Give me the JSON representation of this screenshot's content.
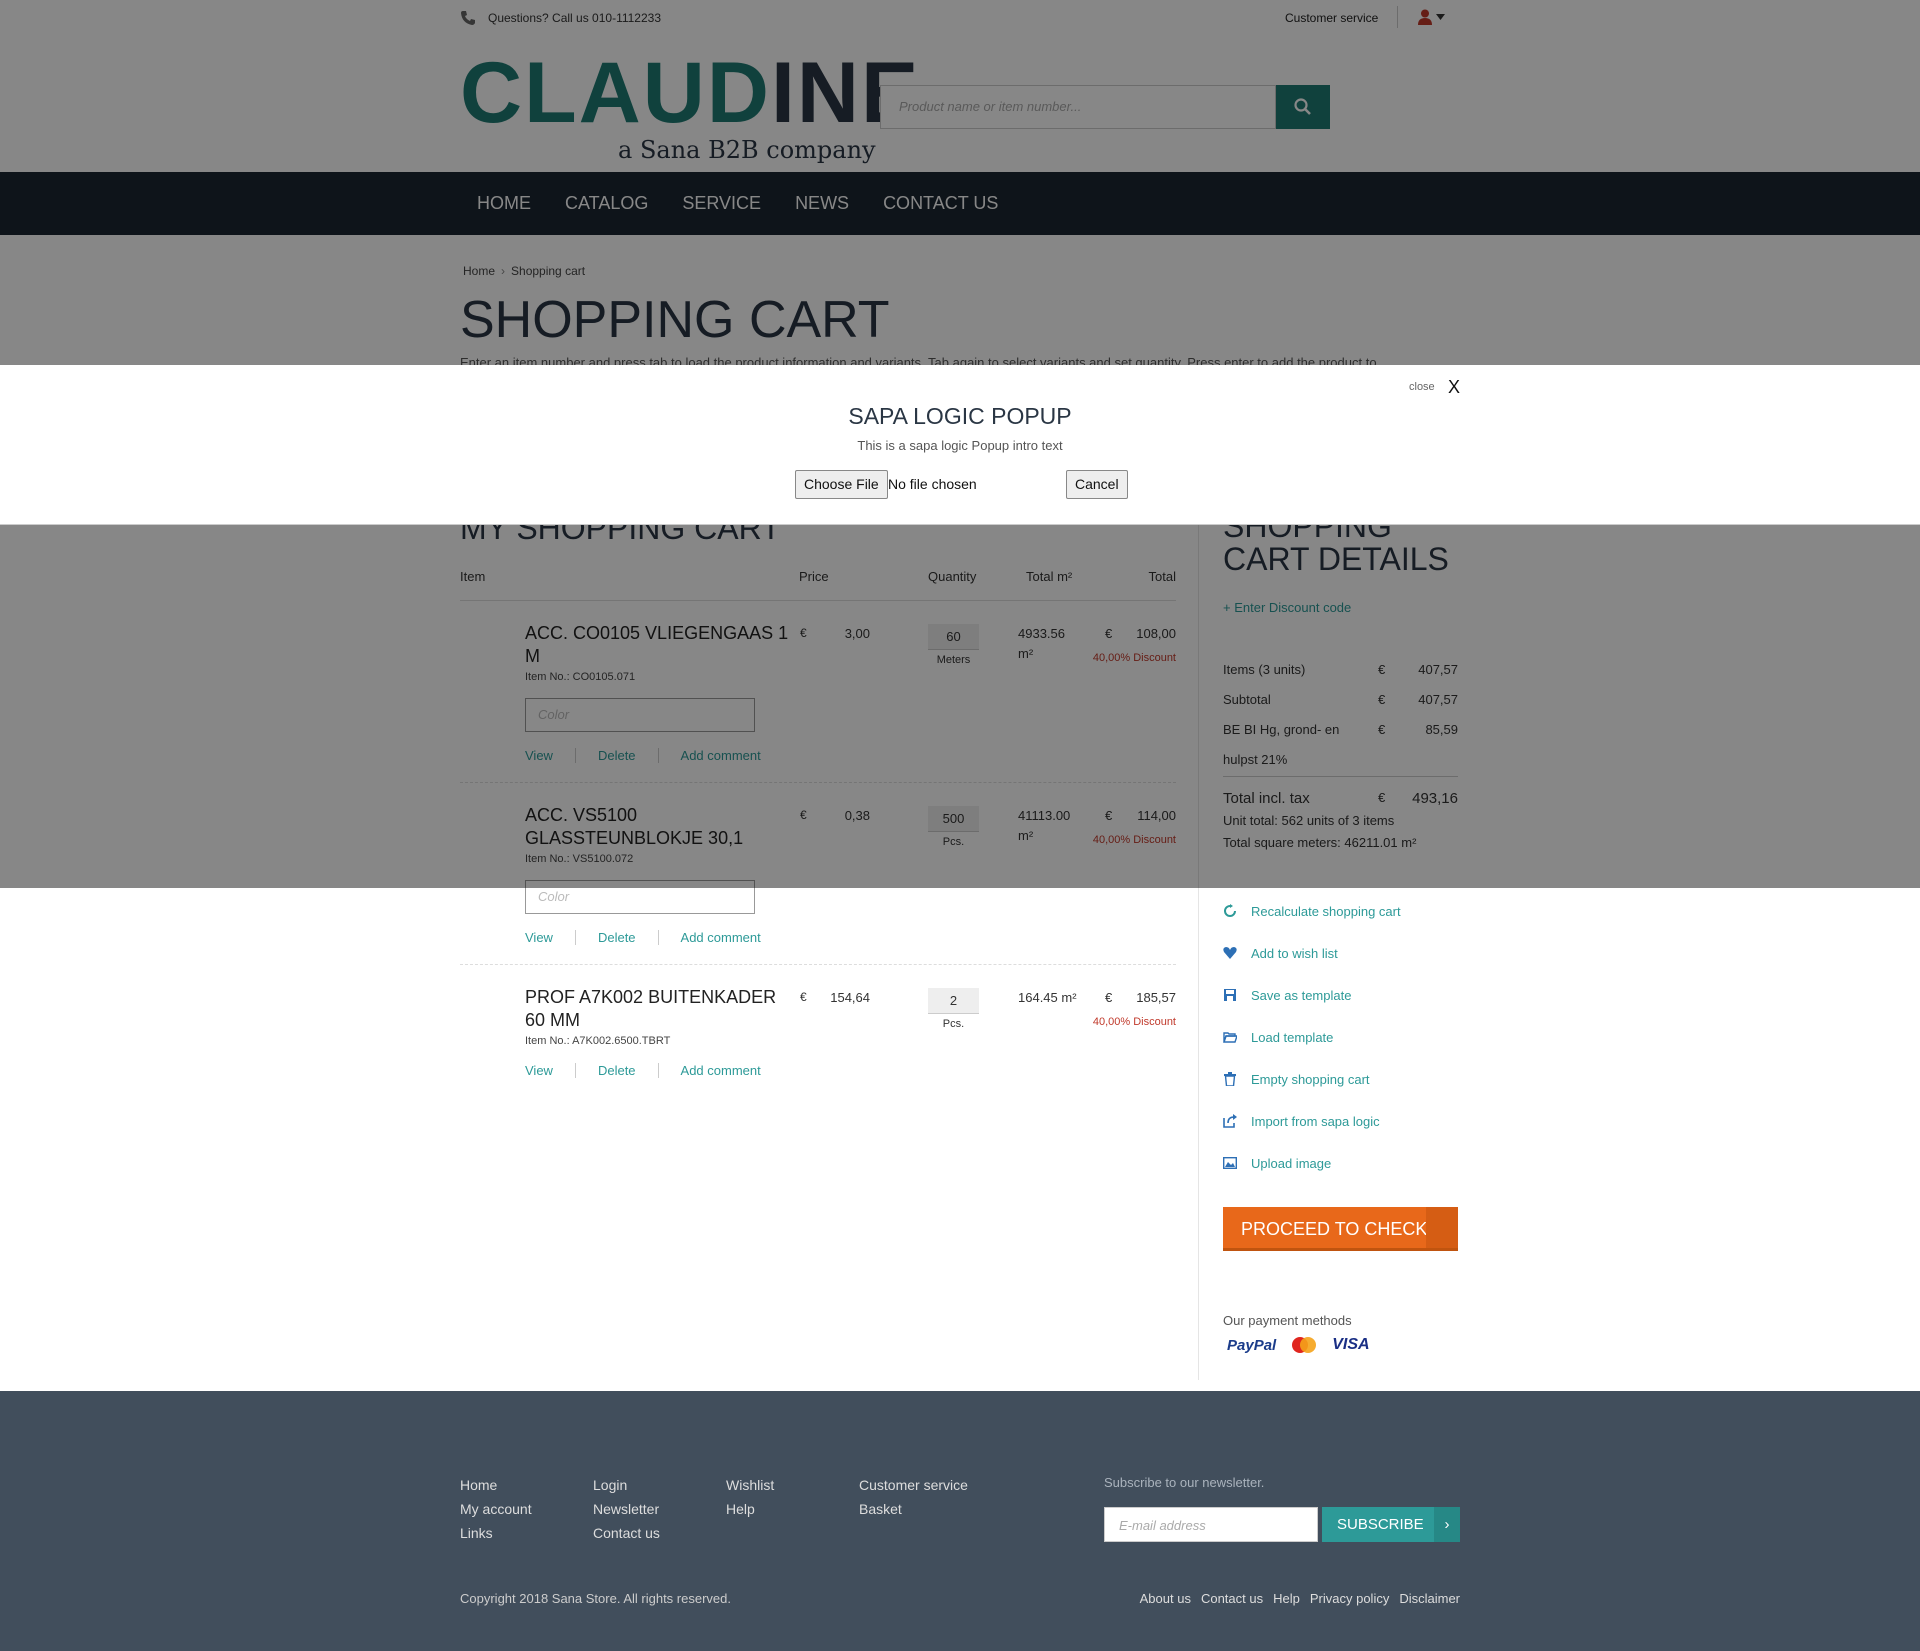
{
  "topbar": {
    "phone_text": "Questions? Call us 010-1112233",
    "customer_service": "Customer service"
  },
  "logo": {
    "part1": "CLAUD",
    "part2": "INE",
    "subtitle": "a Sana B2B company"
  },
  "search": {
    "placeholder": "Product name or item number..."
  },
  "nav": [
    "HOME",
    "CATALOG",
    "SERVICE",
    "NEWS",
    "CONTACT US"
  ],
  "breadcrumb": [
    "Home",
    "Shopping cart"
  ],
  "page_title": "SHOPPING CART",
  "intro": "Enter an item number and press tab to load the product information and variants. Tab again to select variants and set quantity. Press enter to add the product to",
  "cart": {
    "title": "MY SHOPPING CART",
    "headers": {
      "item": "Item",
      "price": "Price",
      "quantity": "Quantity",
      "total_m2": "Total m²",
      "total": "Total"
    },
    "rows": [
      {
        "name": "ACC. CO0105 VLIEGENGAAS 1 M",
        "item_no": "Item No.: CO0105.071",
        "currency": "€",
        "price": "3,00",
        "qty": "60",
        "unit": "Meters",
        "total_m2": "4933.56 m²",
        "total": "108,00",
        "discount": "40,00% Discount",
        "color_placeholder": "Color"
      },
      {
        "name": "ACC. VS5100 GLASSTEUNBLOKJE 30,1",
        "item_no": "Item No.: VS5100.072",
        "currency": "€",
        "price": "0,38",
        "qty": "500",
        "unit": "Pcs.",
        "total_m2": "41113.00 m²",
        "total": "114,00",
        "discount": "40,00% Discount",
        "color_placeholder": "Color"
      },
      {
        "name": "PROF A7K002 BUITENKADER 60 MM",
        "item_no": "Item No.: A7K002.6500.TBRT",
        "currency": "€",
        "price": "154,64",
        "qty": "2",
        "unit": "Pcs.",
        "total_m2": "164.45 m²",
        "total": "185,57",
        "discount": "40,00% Discount"
      }
    ],
    "actions": {
      "view": "View",
      "delete": "Delete",
      "comment": "Add comment"
    }
  },
  "details": {
    "title_line1": "SHOPPING",
    "title_line2": "CART DETAILS",
    "discount_link": "+ Enter Discount code",
    "summary": [
      {
        "label": "Items (3 units)",
        "currency": "€",
        "value": "407,57"
      },
      {
        "label": "Subtotal",
        "currency": "€",
        "value": "407,57"
      },
      {
        "label": "BE BI Hg, grond- en",
        "label2": "hulpst 21%",
        "currency": "€",
        "value": "85,59"
      }
    ],
    "total": {
      "label": "Total incl. tax",
      "currency": "€",
      "value": "493,16"
    },
    "unit_total": "Unit total: 562 units of 3 items",
    "square_meters": "Total square meters: 46211.01 m²",
    "actions": [
      "Recalculate shopping cart",
      "Add to wish list",
      "Save as template",
      "Load template",
      "Empty shopping cart",
      "Import from sapa logic",
      "Upload image"
    ],
    "checkout": "PROCEED TO CHECKOUT",
    "payment_title": "Our payment methods",
    "payment_methods": [
      "PayPal",
      "MasterCard",
      "VISA"
    ]
  },
  "footer": {
    "col1": [
      "Home",
      "My account",
      "Links"
    ],
    "col2": [
      "Login",
      "Newsletter",
      "Contact us"
    ],
    "col3": [
      "Wishlist",
      "Help"
    ],
    "col4": [
      "Customer service",
      "Basket"
    ],
    "newsletter_title": "Subscribe to our newsletter.",
    "email_placeholder": "E-mail address",
    "subscribe": "SUBSCRIBE",
    "copyright": "Copyright 2018 Sana Store. All rights reserved.",
    "links": [
      "About us",
      "Contact us",
      "Help",
      "Privacy policy",
      "Disclaimer"
    ]
  },
  "popup": {
    "title": "SAPA LOGIC POPUP",
    "intro": "This is a sapa logic Popup intro text",
    "close_label": "close",
    "close_x": "X",
    "choose_file": "Choose File",
    "no_file": "No file chosen",
    "cancel": "Cancel"
  },
  "colors": {
    "accent": "#2d9a98",
    "nav": "#1b2632",
    "checkout": "#e8681a",
    "footer": "#414e5c",
    "discount": "#c0392b"
  }
}
